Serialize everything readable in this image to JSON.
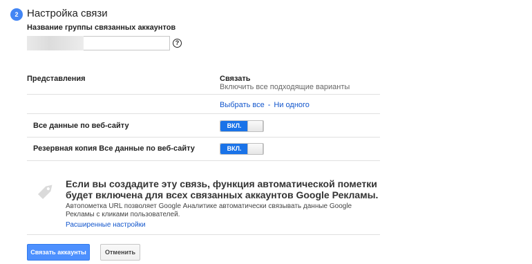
{
  "step": {
    "number": "2",
    "title": "Настройка связи"
  },
  "group_name": {
    "label": "Название группы связанных аккаунтов",
    "value": "",
    "help_icon": "question-circle-icon"
  },
  "views_table": {
    "col_views": "Представления",
    "col_link_title": "Связать",
    "col_link_sub": "Включить все подходящие варианты",
    "select_all": "Выбрать все",
    "separator": "-",
    "select_none": "Ни одного",
    "rows": [
      {
        "label": "Все данные по веб-сайту",
        "toggle_label": "ВКЛ.",
        "on": true
      },
      {
        "label": "Резервная копия Все данные по веб-сайту",
        "toggle_label": "ВКЛ.",
        "on": true
      }
    ]
  },
  "notice": {
    "icon": "tag-icon",
    "title": "Если вы создадите эту связь, функция автоматической пометки будет включена для всех связанных аккаунтов Google Рекламы.",
    "text": "Автопометка URL позволяет Google Аналитике автоматически связывать данные Google Рекламы с кликами пользователей.",
    "link": "Расширенные настройки"
  },
  "actions": {
    "primary": "Связать аккаунты",
    "cancel": "Отменить"
  },
  "colors": {
    "accent": "#4285f4",
    "toggle_on": "#1a73e8",
    "link": "#1155cc"
  }
}
